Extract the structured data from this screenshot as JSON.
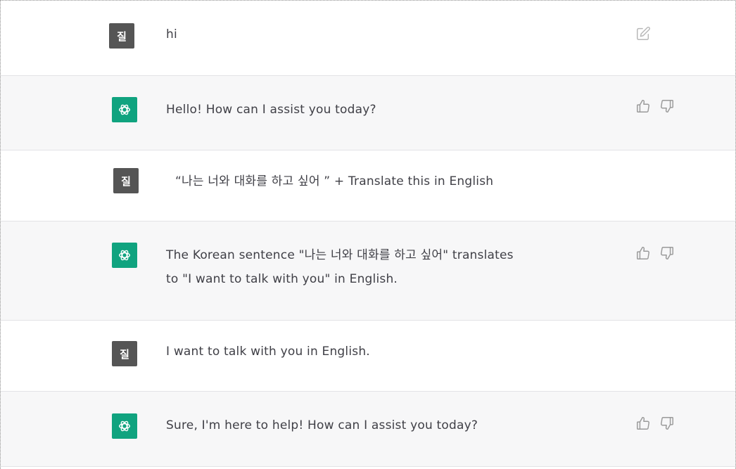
{
  "conversation": {
    "messages": [
      {
        "role": "user",
        "avatar_text": "질",
        "text": "hi"
      },
      {
        "role": "assistant",
        "text": "Hello! How can I assist you today?"
      },
      {
        "role": "user",
        "avatar_text": "질",
        "text": "“나는 너와 대화를 하고 싶어 ” + Translate this in English"
      },
      {
        "role": "assistant",
        "lines": [
          "The Korean sentence \"나는 너와 대화를 하고 싶어\" translates",
          "to \"I want to talk with you\" in English."
        ]
      },
      {
        "role": "user",
        "avatar_text": "질",
        "text": "I want to talk with you in English."
      },
      {
        "role": "assistant",
        "text": "Sure, I'm here to help! How can I assist you today?"
      }
    ]
  },
  "icons": {
    "edit": "edit-icon",
    "thumbs_up": "thumbs-up-icon",
    "thumbs_down": "thumbs-down-icon",
    "assistant_logo": "openai-logo-icon"
  },
  "colors": {
    "assistant_avatar": "#10a37f",
    "user_avatar": "#555555",
    "assistant_row_bg": "#f7f7f8"
  }
}
